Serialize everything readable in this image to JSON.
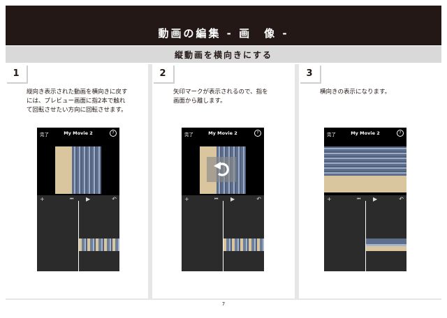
{
  "header": {
    "title": "動画の編集 - 画　像 -"
  },
  "subheader": {
    "title": "縦動画を横向きにする"
  },
  "steps": [
    {
      "number": "1",
      "lines": [
        "縦向き表示された動画を横向きに戻す",
        "には、プレビュー画面に指2本で触れ",
        "て回転させたい方向に回転させます。"
      ]
    },
    {
      "number": "2",
      "lines": [
        "矢印マークが表示されるので、指を",
        "画面から離します。"
      ]
    },
    {
      "number": "3",
      "lines": [
        "横向きの表示になります。"
      ]
    }
  ],
  "phone": {
    "done_label": "完了",
    "title": "My Movie 2",
    "help_label": "?",
    "add_label": "+",
    "rewind_label": "⏮",
    "play_label": "▶",
    "undo_label": "↶"
  },
  "footer": {
    "page_number": "7"
  }
}
